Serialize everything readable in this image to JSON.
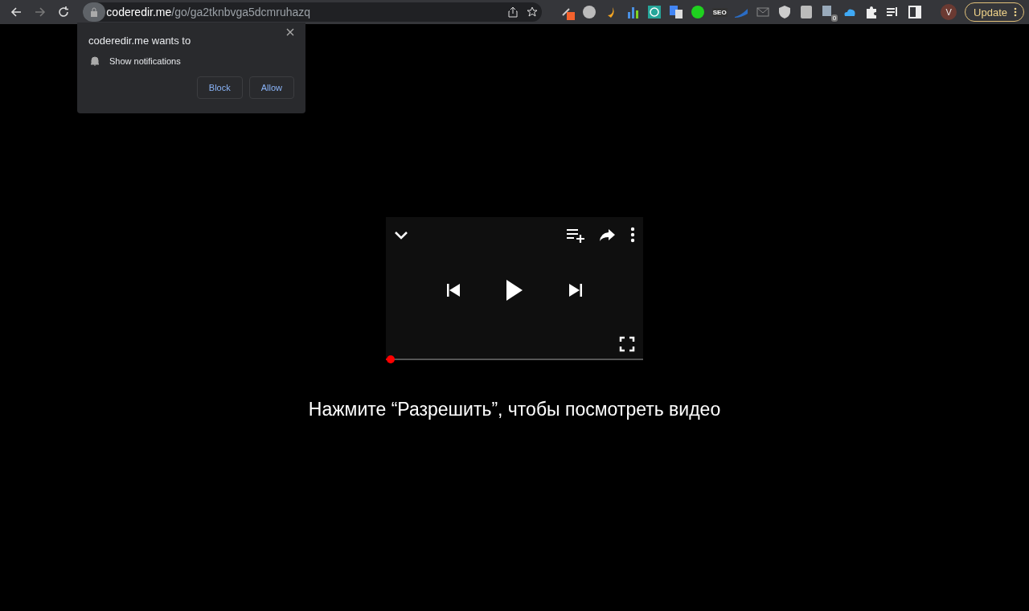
{
  "browser": {
    "url_host": "coderedir.me",
    "url_path": "/go/ga2tknbvga5dcmruhazq",
    "extensions": [
      {
        "kind": "dropper"
      },
      {
        "kind": "scircle"
      },
      {
        "kind": "flame"
      },
      {
        "kind": "bars"
      },
      {
        "kind": "cycle"
      },
      {
        "kind": "translate"
      },
      {
        "kind": "thumb"
      },
      {
        "kind": "seo",
        "label": "SEO"
      },
      {
        "kind": "wave"
      },
      {
        "kind": "mail"
      },
      {
        "kind": "shield"
      },
      {
        "kind": "file"
      },
      {
        "kind": "copy",
        "badge": "0"
      },
      {
        "kind": "cloud"
      },
      {
        "kind": "puzzle"
      },
      {
        "kind": "playlist"
      },
      {
        "kind": "sidebar"
      }
    ],
    "avatar": "V",
    "update_button": "Update"
  },
  "permission_popup": {
    "title": "coderedir.me wants to",
    "permission": "Show notifications",
    "buttons": [
      "Block",
      "Allow"
    ]
  },
  "player": {
    "progress": {
      "level": 0.01
    }
  },
  "caption": "Нажмите “Разрешить”, чтобы посмотреть видео"
}
